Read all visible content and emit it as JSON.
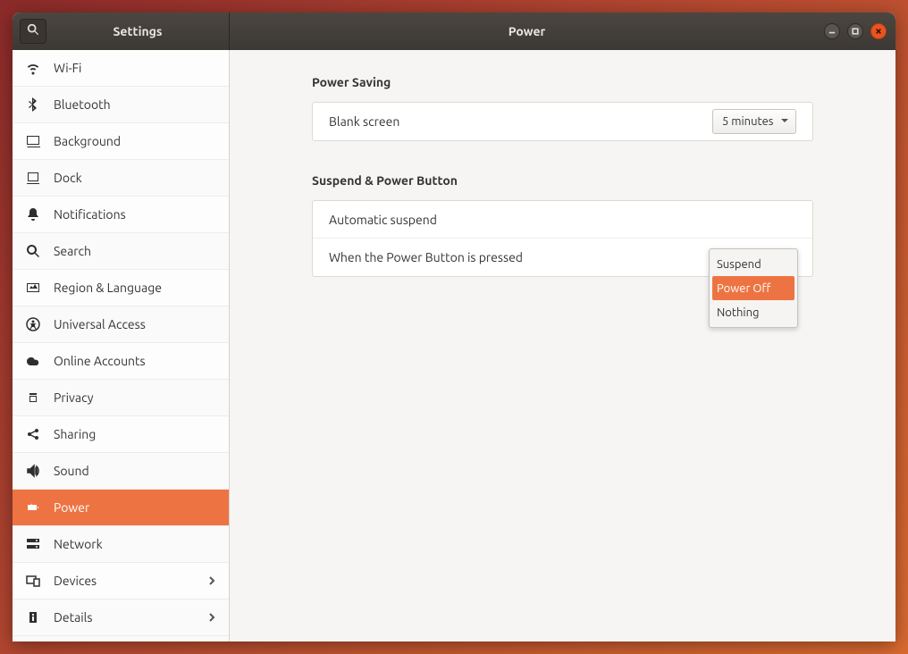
{
  "titlebar": {
    "app_title": "Settings",
    "page_title": "Power"
  },
  "sidebar": {
    "items": [
      {
        "id": "wifi",
        "label": "Wi-Fi"
      },
      {
        "id": "bluetooth",
        "label": "Bluetooth"
      },
      {
        "id": "background",
        "label": "Background"
      },
      {
        "id": "dock",
        "label": "Dock"
      },
      {
        "id": "notifications",
        "label": "Notifications"
      },
      {
        "id": "search",
        "label": "Search"
      },
      {
        "id": "region-language",
        "label": "Region & Language"
      },
      {
        "id": "universal-access",
        "label": "Universal Access"
      },
      {
        "id": "online-accounts",
        "label": "Online Accounts"
      },
      {
        "id": "privacy",
        "label": "Privacy"
      },
      {
        "id": "sharing",
        "label": "Sharing"
      },
      {
        "id": "sound",
        "label": "Sound"
      },
      {
        "id": "power",
        "label": "Power"
      },
      {
        "id": "network",
        "label": "Network"
      },
      {
        "id": "devices",
        "label": "Devices"
      },
      {
        "id": "details",
        "label": "Details"
      }
    ]
  },
  "sections": {
    "power_saving": {
      "title": "Power Saving",
      "blank_screen_label": "Blank screen",
      "blank_screen_value": "5 minutes"
    },
    "suspend": {
      "title": "Suspend & Power Button",
      "auto_suspend_label": "Automatic suspend",
      "power_button_label": "When the Power Button is pressed"
    }
  },
  "popup": {
    "items": [
      {
        "label": "Suspend"
      },
      {
        "label": "Power Off"
      },
      {
        "label": "Nothing"
      }
    ]
  }
}
